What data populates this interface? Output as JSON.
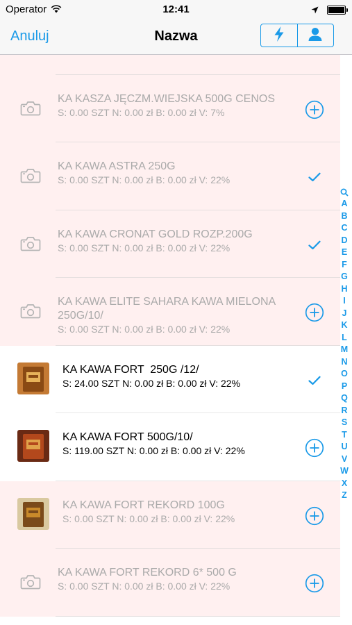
{
  "status_bar": {
    "carrier": "Operator",
    "time": "12:41"
  },
  "nav": {
    "cancel_label": "Anuluj",
    "title": "Nazwa"
  },
  "colors": {
    "accent": "#1a9ae8",
    "row_inactive_bg": "#fff0f0",
    "row_active_bg": "#ffffff",
    "text_inactive": "#aaaaaa"
  },
  "products": [
    {
      "name": "",
      "meta": "S: 0.00 SZT N: 0.00 zł B: 0.00 zł V: 7%",
      "image": "camera-icon",
      "status": "plus-circle-icon",
      "active": false
    },
    {
      "name": "KA KASZA JĘCZM.WIEJSKA 500G CENOS",
      "meta": "S: 0.00 SZT N: 0.00 zł B: 0.00 zł V: 7%",
      "image": "camera-icon",
      "status": "plus-circle-icon",
      "active": false
    },
    {
      "name": "KA KAWA ASTRA 250G",
      "meta": "S: 0.00 SZT N: 0.00 zł B: 0.00 zł V: 22%",
      "image": "camera-icon",
      "status": "checkmark-icon",
      "active": false
    },
    {
      "name": "KA KAWA CRONAT GOLD ROZP.200G",
      "meta": "S: 0.00 SZT N: 0.00 zł B: 0.00 zł V: 22%",
      "image": "camera-icon",
      "status": "checkmark-icon",
      "active": false
    },
    {
      "name": "KA KAWA ELITE SAHARA KAWA MIELONA\n250G/10/",
      "meta": "S: 0.00 SZT N: 0.00 zł B: 0.00 zł V: 22%",
      "image": "camera-icon",
      "status": "plus-circle-icon",
      "active": false
    },
    {
      "name": "KA KAWA FORT  250G /12/",
      "meta": "S: 24.00 SZT N: 0.00 zł B: 0.00 zł V: 22%",
      "image": "product-photo-coffee-box",
      "status": "checkmark-icon",
      "active": true
    },
    {
      "name": "KA KAWA FORT 500G/10/",
      "meta": "S: 119.00 SZT N: 0.00 zł B: 0.00 zł V: 22%",
      "image": "product-photo-coffee-bag",
      "status": "plus-circle-icon",
      "active": true
    },
    {
      "name": "KA KAWA FORT REKORD 100G",
      "meta": "S: 0.00 SZT N: 0.00 zł B: 0.00 zł V: 22%",
      "image": "product-photo-coffee-pack",
      "status": "plus-circle-icon",
      "active": false
    },
    {
      "name": "KA KAWA FORT REKORD 6* 500 G",
      "meta": "S: 0.00 SZT N: 0.00 zł B: 0.00 zł V: 22%",
      "image": "camera-icon",
      "status": "plus-circle-icon",
      "active": false
    }
  ],
  "index_letters": [
    "A",
    "B",
    "C",
    "D",
    "E",
    "F",
    "G",
    "H",
    "I",
    "J",
    "K",
    "L",
    "M",
    "N",
    "O",
    "P",
    "Q",
    "R",
    "S",
    "T",
    "U",
    "V",
    "W",
    "X",
    "Z"
  ]
}
